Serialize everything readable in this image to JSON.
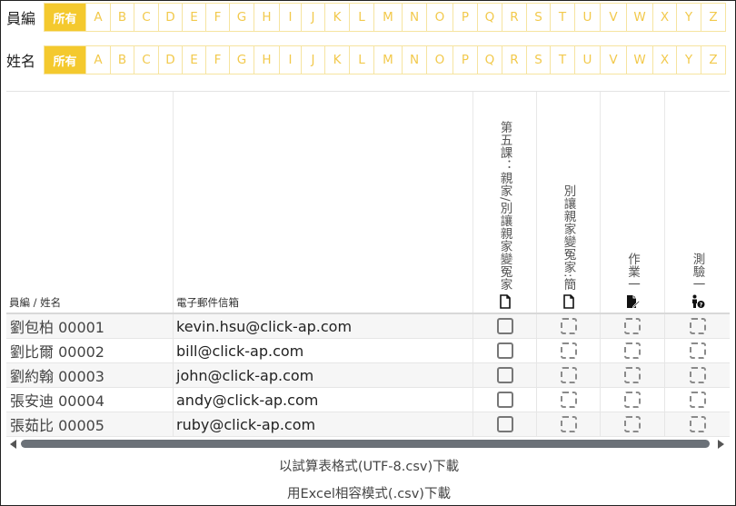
{
  "filters": {
    "row1_label": "員編",
    "row2_label": "姓名",
    "all_label": "所有",
    "letters": [
      "A",
      "B",
      "C",
      "D",
      "E",
      "F",
      "G",
      "H",
      "I",
      "J",
      "K",
      "L",
      "M",
      "N",
      "O",
      "P",
      "Q",
      "R",
      "S",
      "T",
      "U",
      "V",
      "W",
      "X",
      "Y",
      "Z"
    ]
  },
  "table": {
    "columns": {
      "id_name": "員編 / 姓名",
      "email": "電子郵件信箱",
      "col1": "第五課：親家/別讓親家變冤家",
      "col2": "別讓親家變冤家:簡",
      "col3": "作業一",
      "col4": "測驗一"
    },
    "icons": {
      "col1": "document-icon",
      "col2": "document-icon",
      "col3": "homework-edit-icon",
      "col4": "quiz-person-icon"
    },
    "rows": [
      {
        "name": "劉包柏 00001",
        "email": "kevin.hsu@click-ap.com"
      },
      {
        "name": "劉比爾 00002",
        "email": "bill@click-ap.com"
      },
      {
        "name": "劉約翰 00003",
        "email": "john@click-ap.com"
      },
      {
        "name": "張安迪 00004",
        "email": "andy@click-ap.com"
      },
      {
        "name": "張茹比 00005",
        "email": "ruby@click-ap.com"
      }
    ]
  },
  "downloads": {
    "csv_utf8": "以試算表格式(UTF-8.csv)下載",
    "csv_excel": "用Excel相容模式(.csv)下載"
  },
  "colors": {
    "accent": "#f4c92e",
    "letter_text": "#f2c94c",
    "scroll_thumb": "#6b7178"
  }
}
